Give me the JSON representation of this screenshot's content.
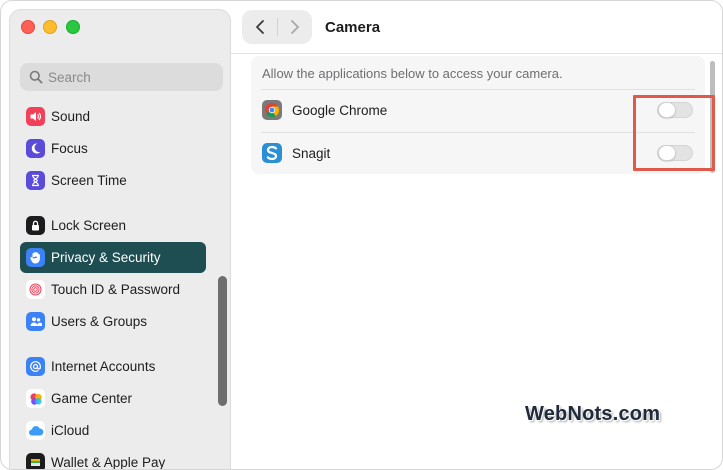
{
  "window": {
    "title": "Camera"
  },
  "search": {
    "placeholder": "Search"
  },
  "sidebar": {
    "items": [
      {
        "label": "Sound",
        "icon": "speaker-icon",
        "color": "#f0405a"
      },
      {
        "label": "Focus",
        "icon": "moon-icon",
        "color": "#5b4bd9"
      },
      {
        "label": "Screen Time",
        "icon": "hourglass-icon",
        "color": "#5b4bd9"
      },
      {
        "label": "Lock Screen",
        "icon": "lock-icon",
        "color": "#1c1c1e"
      },
      {
        "label": "Privacy & Security",
        "icon": "hand-icon",
        "color": "#3b82f6",
        "active": true
      },
      {
        "label": "Touch ID & Password",
        "icon": "fingerprint-icon",
        "color": "#ffffff"
      },
      {
        "label": "Users & Groups",
        "icon": "users-icon",
        "color": "#3b82f6"
      },
      {
        "label": "Internet Accounts",
        "icon": "at-icon",
        "color": "#3b82f6"
      },
      {
        "label": "Game Center",
        "icon": "game-center-icon",
        "color": "#ffffff"
      },
      {
        "label": "iCloud",
        "icon": "cloud-icon",
        "color": "#ffffff"
      },
      {
        "label": "Wallet & Apple Pay",
        "icon": "wallet-icon",
        "color": "#1c1c1e"
      }
    ]
  },
  "camera": {
    "description": "Allow the applications below to access your camera.",
    "apps": [
      {
        "label": "Google Chrome",
        "icon": "chrome-icon",
        "enabled": false
      },
      {
        "label": "Snagit",
        "icon": "snagit-icon",
        "enabled": false
      }
    ]
  },
  "watermark": {
    "text": "WebNots.com"
  },
  "colors": {
    "accent_active": "#1e4d52",
    "highlight": "#e05a4a"
  }
}
